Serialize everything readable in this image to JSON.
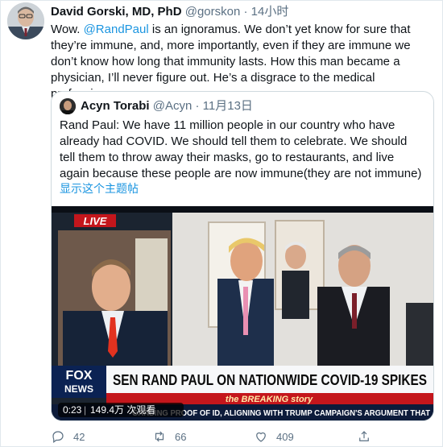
{
  "tweet": {
    "author_name": "David Gorski, MD, PhD",
    "author_handle": "@gorskon",
    "separator": "·",
    "time": "14小时",
    "text_before_mention": "Wow. ",
    "mention": "@RandPaul",
    "text_after_mention": " is an ignoramus. We don’t yet know for sure that they’re immune, and, more importantly, even if they are immune we don’t know how long that immunity lasts. How this man became a physician, I’ll never figure out. He’s a disgrace to the medical profession."
  },
  "quoted": {
    "author_name": "Acyn Torabi",
    "author_handle": "@Acyn",
    "separator": "·",
    "time": "11月13日",
    "text": "Rand Paul: We have 11 million people in our country who have already had COVID. We should tell them to celebrate. We should tell them to throw away their masks, go to restaurants, and live again because these people are now immune(they are not immune)",
    "show_thread": "显示这个主题帖"
  },
  "video": {
    "live_badge": "LIVE",
    "channel_line1": "FOX",
    "channel_line2": "NEWS",
    "headline": "SEN RAND PAUL ON NATIONWIDE COVID-19 SPIKES",
    "breaking": "the BREAKING story",
    "ticker": "GARDING PROOF OF ID, ALIGNING WITH TRUMP CAMPAIGN'S ARGUMENT THAT",
    "duration": "0:23",
    "views": "149.4万 次观看"
  },
  "actions": {
    "reply_count": "42",
    "retweet_count": "66",
    "like_count": "409"
  },
  "colors": {
    "link": "#1b95e0",
    "secondary_text": "#5b7083",
    "fox_red": "#c4161c",
    "fox_navy": "#0b2253"
  }
}
